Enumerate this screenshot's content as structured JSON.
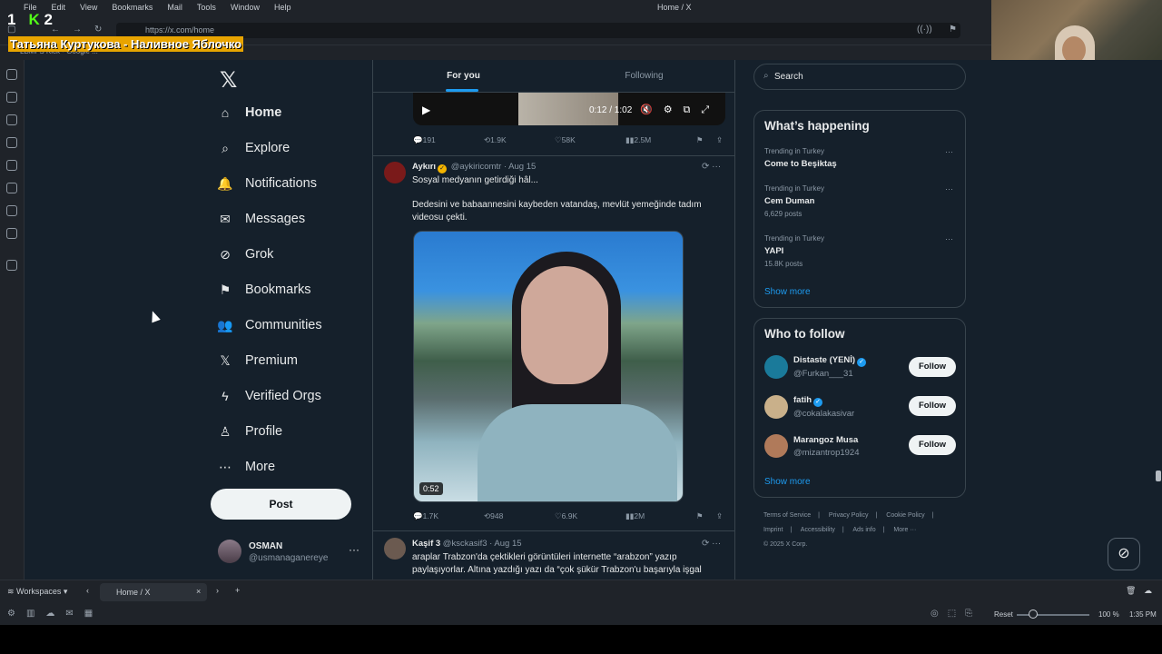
{
  "os_menu": [
    "File",
    "Edit",
    "View",
    "Bookmarks",
    "Mail",
    "Tools",
    "Window",
    "Help"
  ],
  "window_title": "Home / X",
  "url": "https://x.com/home",
  "bookmarks_bar": "LBMFS    Kick - Google ...",
  "stream_overlay": {
    "num1": "1",
    "num2": "2",
    "k": "K",
    "banner": "Татьяна Куртукова - Наливное Яблочко"
  },
  "nav": {
    "logo": "𝕏",
    "items": [
      {
        "label": "Home",
        "icon": "⌂"
      },
      {
        "label": "Explore",
        "icon": "⌕"
      },
      {
        "label": "Notifications",
        "icon": "🔔"
      },
      {
        "label": "Messages",
        "icon": "✉"
      },
      {
        "label": "Grok",
        "icon": "⊘"
      },
      {
        "label": "Bookmarks",
        "icon": "⚑"
      },
      {
        "label": "Communities",
        "icon": "👥"
      },
      {
        "label": "Premium",
        "icon": "𝕏"
      },
      {
        "label": "Verified Orgs",
        "icon": "ϟ"
      },
      {
        "label": "Profile",
        "icon": "♙"
      },
      {
        "label": "More",
        "icon": "⋯"
      }
    ],
    "post_label": "Post",
    "me": {
      "name": "OSMAN",
      "handle": "@usmanaganereye"
    }
  },
  "feed": {
    "tabs": [
      "For you",
      "Following"
    ],
    "video_top": {
      "time": "0:12 / 1:02"
    },
    "tweet0_actions": {
      "replies": "191",
      "reposts": "1.9K",
      "likes": "58K",
      "views": "2.5M"
    },
    "tweet1": {
      "name": "Aykırı",
      "handle": "@aykiricomtr",
      "date": "· Aug 15",
      "line1": "Sosyal medyanın getirdiği hâl...",
      "line2": "Dedesini ve babaannesini kaybeden vatandaş, mevlüt yemeğinde tadım videosu çekti.",
      "duration": "0:52",
      "actions": {
        "replies": "1.7K",
        "reposts": "948",
        "likes": "6.9K",
        "views": "2M"
      }
    },
    "tweet2": {
      "name": "Kaşif 3",
      "handle": "@ksckasif3",
      "date": "· Aug 15",
      "text": "araplar Trabzon'da çektikleri görüntüleri internette “arabzon” yazıp paylaşıyorlar. Altına yazdığı yazı da “çok şükür Trabzon'u başarıyla işgal"
    }
  },
  "sidebar": {
    "search_placeholder": "Search",
    "happening_title": "What’s happening",
    "trends": [
      {
        "context": "Trending in Turkey",
        "name": "Come to Beşiktaş",
        "posts": ""
      },
      {
        "context": "Trending in Turkey",
        "name": "Cem Duman",
        "posts": "6,629 posts"
      },
      {
        "context": "Trending in Turkey",
        "name": "YAPI",
        "posts": "15.8K posts"
      }
    ],
    "show_more": "Show more",
    "wtf_title": "Who to follow",
    "follow": [
      {
        "name": "Distaste (YENİ)",
        "handle": "@Furkan___31",
        "button": "Follow"
      },
      {
        "name": "fatih",
        "handle": "@cokalakasivar",
        "button": "Follow"
      },
      {
        "name": "Marangoz Musa",
        "handle": "@mizantrop1924",
        "button": "Follow"
      }
    ],
    "footer": [
      "Terms of Service",
      "|",
      "Privacy Policy",
      "|",
      "Cookie Policy",
      "|",
      "Imprint",
      "|",
      "Accessibility",
      "|",
      "Ads info",
      "|",
      "More ···",
      "© 2025 X Corp."
    ]
  },
  "tabbar": {
    "workspaces": "Workspaces",
    "tab_title": "Home / X",
    "close": "×",
    "add": "+"
  },
  "statusbar": {
    "reset": "Reset",
    "zoom": "100 %",
    "clock": "1:35 PM"
  },
  "colors": {
    "bg": "#15202b",
    "accent": "#1d9bf0",
    "border": "#38444d",
    "text_muted": "#8b98a5"
  }
}
